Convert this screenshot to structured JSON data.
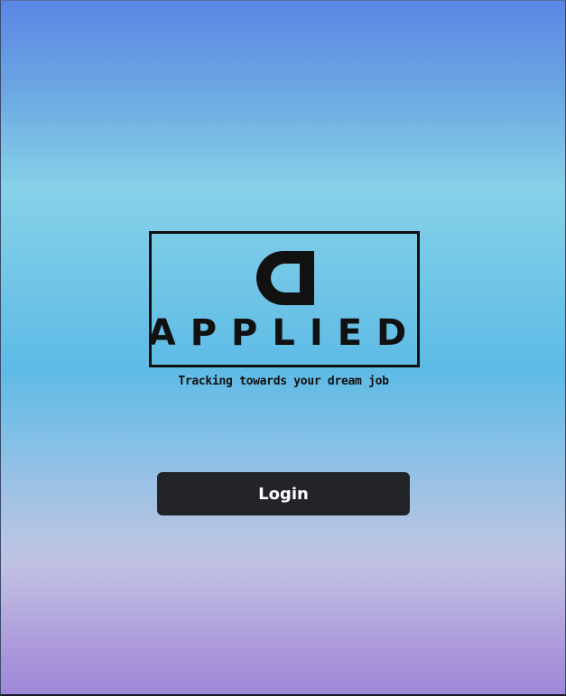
{
  "logo": {
    "icon": "applied-logo-icon",
    "wordmark": "APPLIED",
    "tagline": "Tracking towards your dream job"
  },
  "actions": {
    "login_label": "Login"
  },
  "colors": {
    "gradient_top": "#5b86e5",
    "gradient_mid": "#86d1e8",
    "gradient_bottom": "#9e89d8",
    "button_bg": "#222428",
    "button_text": "#ffffff",
    "ink": "#111111"
  }
}
